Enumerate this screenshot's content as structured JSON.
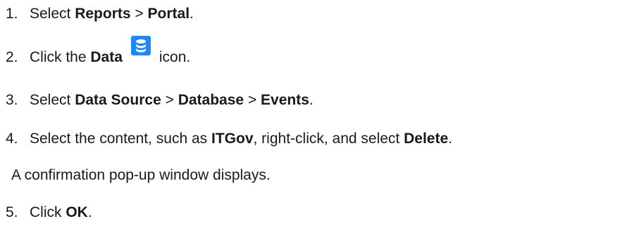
{
  "steps": [
    {
      "number": "1.",
      "text_before": "Select ",
      "bold_1": "Reports",
      "separator_1": ">",
      "bold_2": "Portal",
      "text_after": "."
    },
    {
      "number": "2.",
      "text_before": "Click the ",
      "bold_1": "Data",
      "icon": "database-icon",
      "text_after": "icon."
    },
    {
      "number": "3.",
      "text_before": "Select ",
      "bold_1": "Data Source",
      "separator_1": ">",
      "bold_2": "Database",
      "separator_2": ">",
      "bold_3": "Events",
      "text_after": "."
    },
    {
      "number": "4.",
      "text_before": "Select the content, such as ",
      "bold_1": "ITGov",
      "text_middle": ", right-click, and select ",
      "bold_2": "Delete",
      "text_after": ".",
      "note": "A confirmation pop-up window displays."
    },
    {
      "number": "5.",
      "text_before": "Click ",
      "bold_1": "OK",
      "text_after": "."
    }
  ],
  "colors": {
    "icon_background": "#1e88f5",
    "text": "#1a1a1a"
  }
}
